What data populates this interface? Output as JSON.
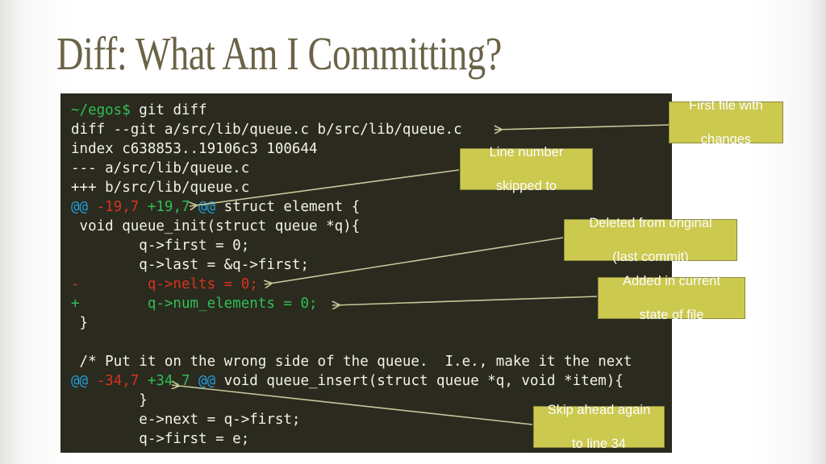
{
  "slide": {
    "title": "Diff: What Am I Committing?",
    "title_color": "#6b6348",
    "background_color": "#ffffff"
  },
  "terminal": {
    "background_color": "#2b2a1e",
    "default_text_color": "#f2f2ec",
    "prompt": "~/egos$",
    "prompt_color": "#2fbf57",
    "command": "git diff",
    "colors": {
      "added": "#2fbf57",
      "removed": "#d8341f",
      "hunk_marker": "#1f9fdd",
      "context": "#f2f2ec"
    },
    "lines": [
      {
        "type": "prompt",
        "prompt": "~/egos$",
        "command": " git diff"
      },
      {
        "type": "context",
        "text": "diff --git a/src/lib/queue.c b/src/lib/queue.c"
      },
      {
        "type": "context",
        "text": "index c638853..19106c3 100644"
      },
      {
        "type": "context",
        "text": "--- a/src/lib/queue.c"
      },
      {
        "type": "context",
        "text": "+++ b/src/lib/queue.c"
      },
      {
        "type": "hunk",
        "at_open": "@@",
        "old_range": " -19,7",
        "new_range": " +19,7",
        "at_close": " @@",
        "heading": " struct element {"
      },
      {
        "type": "context",
        "text": " void queue_init(struct queue *q){"
      },
      {
        "type": "context",
        "text": "        q->first = 0;"
      },
      {
        "type": "context",
        "text": "        q->last = &q->first;"
      },
      {
        "type": "removed",
        "marker": "-",
        "text": "        q->nelts = 0;"
      },
      {
        "type": "added",
        "marker": "+",
        "text": "        q->num_elements = 0;"
      },
      {
        "type": "context",
        "text": " }"
      },
      {
        "type": "context",
        "text": ""
      },
      {
        "type": "context",
        "text": " /* Put it on the wrong side of the queue.  I.e., make it the next"
      },
      {
        "type": "hunk",
        "at_open": "@@",
        "old_range": " -34,7",
        "new_range": " +34,7",
        "at_close": " @@",
        "heading": " void queue_insert(struct queue *q, void *item){"
      },
      {
        "type": "context",
        "text": "        }"
      },
      {
        "type": "context",
        "text": "        e->next = q->first;"
      },
      {
        "type": "context",
        "text": "        q->first = e;"
      }
    ]
  },
  "callouts": [
    {
      "id": "first-file-with-changes",
      "line1": "First file with",
      "line2": "changes"
    },
    {
      "id": "line-number-skipped-to",
      "line1": "Line number",
      "line2": "skipped to"
    },
    {
      "id": "deleted-from-original",
      "line1": "Deleted from original",
      "line2": "(last commit)"
    },
    {
      "id": "added-in-current-state",
      "line1": "Added in current",
      "line2": "state of file"
    },
    {
      "id": "skip-ahead-again",
      "line1": "Skip ahead again",
      "line2": "to line 34"
    }
  ],
  "annotation_style": {
    "box_fill": "#ccc94f",
    "box_border": "#8d8a3e",
    "box_text": "#ffffff",
    "arrow_color": "#c9c79a"
  }
}
